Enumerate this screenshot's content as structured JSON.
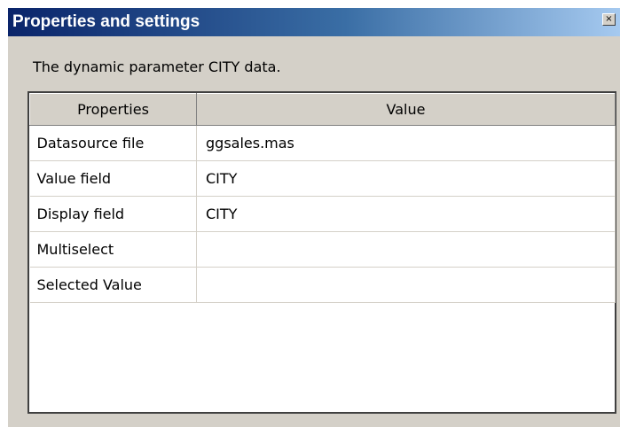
{
  "window": {
    "title": "Properties and settings",
    "close_glyph": "×"
  },
  "description": "The dynamic parameter CITY data.",
  "grid": {
    "columns": [
      "Properties",
      "Value"
    ],
    "rows": [
      {
        "property": "Datasource file",
        "value": "ggsales.mas"
      },
      {
        "property": "Value field",
        "value": "CITY"
      },
      {
        "property": "Display field",
        "value": "CITY"
      },
      {
        "property": "Multiselect",
        "value": ""
      },
      {
        "property": "Selected Value",
        "value": ""
      }
    ]
  },
  "icons": {
    "close": "close-icon"
  },
  "colors": {
    "title_bar_start": "#0a246a",
    "title_bar_end": "#a6caf0",
    "dialog_face": "#d4d0c8",
    "grid_background": "#ffffff"
  }
}
